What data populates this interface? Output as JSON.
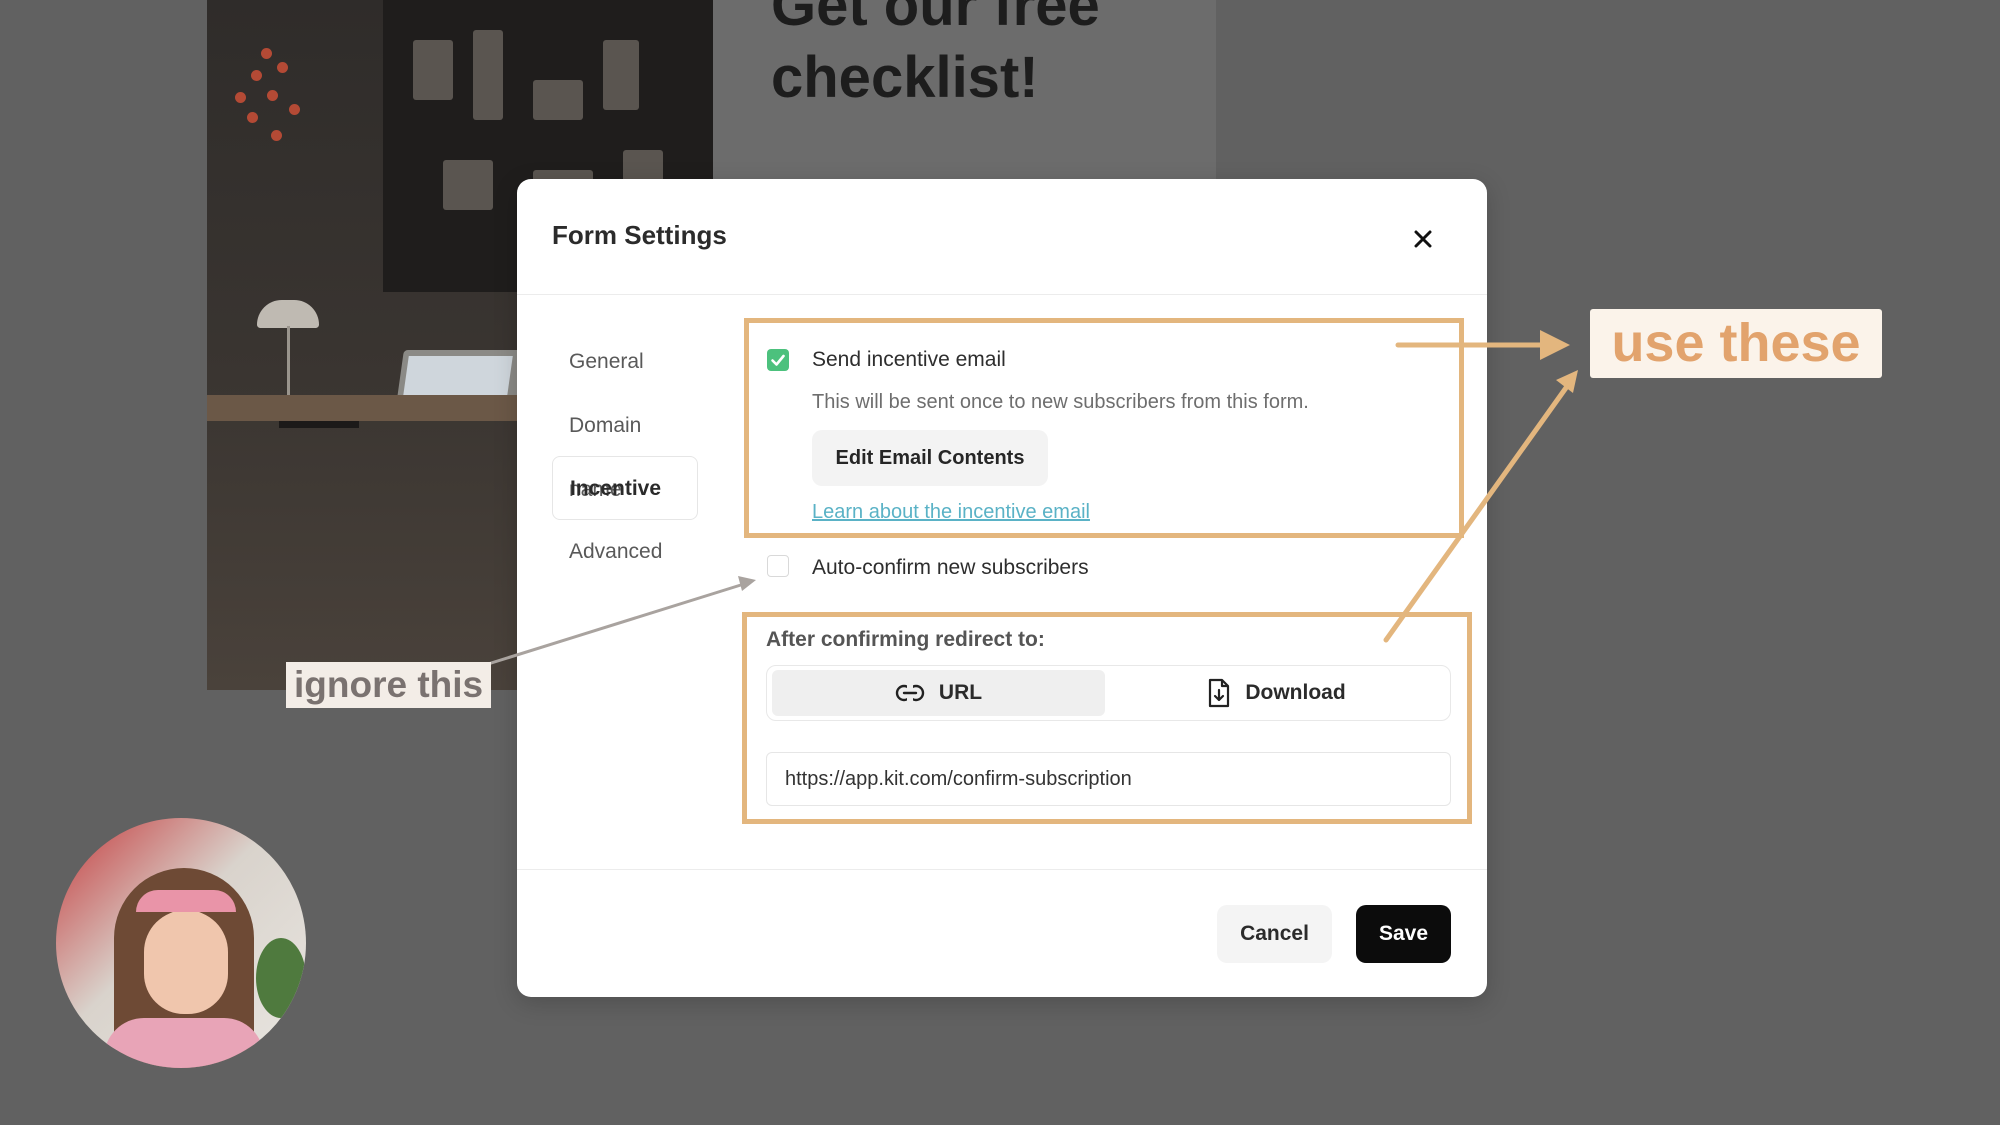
{
  "background": {
    "heading": "Get our free checklist!"
  },
  "annotations": {
    "ignore_label": "ignore this",
    "use_label": "use these",
    "highlight_color": "#e3b67e"
  },
  "modal": {
    "title": "Form Settings",
    "close_icon": "close-icon",
    "nav": {
      "items": [
        {
          "label": "General"
        },
        {
          "label": "Domain name"
        },
        {
          "label": "Incentive"
        },
        {
          "label": "Advanced"
        }
      ],
      "active": "Incentive"
    },
    "incentive": {
      "send_email_label": "Send incentive email",
      "send_email_checked": true,
      "description": "This will be sent once to new subscribers from this form.",
      "edit_button": "Edit Email Contents",
      "learn_link": "Learn about the incentive email",
      "auto_confirm_label": "Auto-confirm new subscribers",
      "auto_confirm_checked": false
    },
    "redirect": {
      "heading": "After confirming redirect to:",
      "options": [
        {
          "label": "URL",
          "icon": "link-icon"
        },
        {
          "label": "Download",
          "icon": "file-download-icon"
        }
      ],
      "selected": "URL",
      "url_value": "https://app.kit.com/confirm-subscription"
    },
    "footer": {
      "cancel": "Cancel",
      "save": "Save"
    }
  },
  "colors": {
    "accent_green": "#4cc17d",
    "link": "#5ab2c6",
    "primary_button": "#0c0c0c"
  }
}
